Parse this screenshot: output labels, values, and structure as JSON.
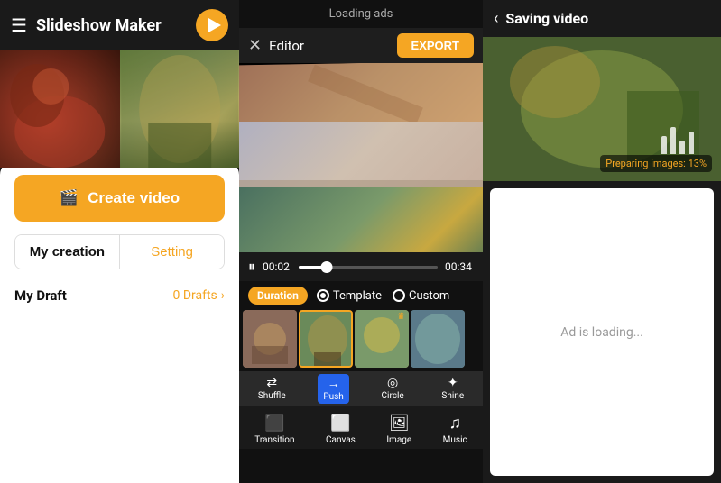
{
  "app": {
    "title": "Slideshow Maker"
  },
  "header": {
    "ads_text": "Loading ads"
  },
  "left": {
    "create_btn_label": "Create video",
    "tab_my_creation": "My creation",
    "tab_setting": "Setting",
    "draft_label": "My Draft",
    "draft_count": "0 Drafts"
  },
  "editor": {
    "close_icon": "✕",
    "label": "Editor",
    "export_label": "EXPORT",
    "time_start": "00:02",
    "time_end": "00:34",
    "duration_label": "Duration",
    "radio_template": "Template",
    "radio_custom": "Custom",
    "transitions": [
      {
        "label": "Shuffle",
        "active": false
      },
      {
        "label": "Push",
        "active": true
      },
      {
        "label": "Circle",
        "active": false
      },
      {
        "label": "Shine",
        "active": false
      }
    ],
    "tools": [
      {
        "label": "Transition",
        "icon": "⬛"
      },
      {
        "label": "Canvas",
        "icon": "⬜"
      },
      {
        "label": "Image",
        "icon": "🖼"
      },
      {
        "label": "Music",
        "icon": "♫"
      }
    ]
  },
  "saving": {
    "back_icon": "‹",
    "title": "Saving video",
    "preparing_text": "Preparing images: 13%",
    "ad_text": "Ad is loading..."
  },
  "colors": {
    "accent": "#f5a623",
    "active_tab": "#2563eb",
    "dark_bg": "#1a1a1a"
  }
}
